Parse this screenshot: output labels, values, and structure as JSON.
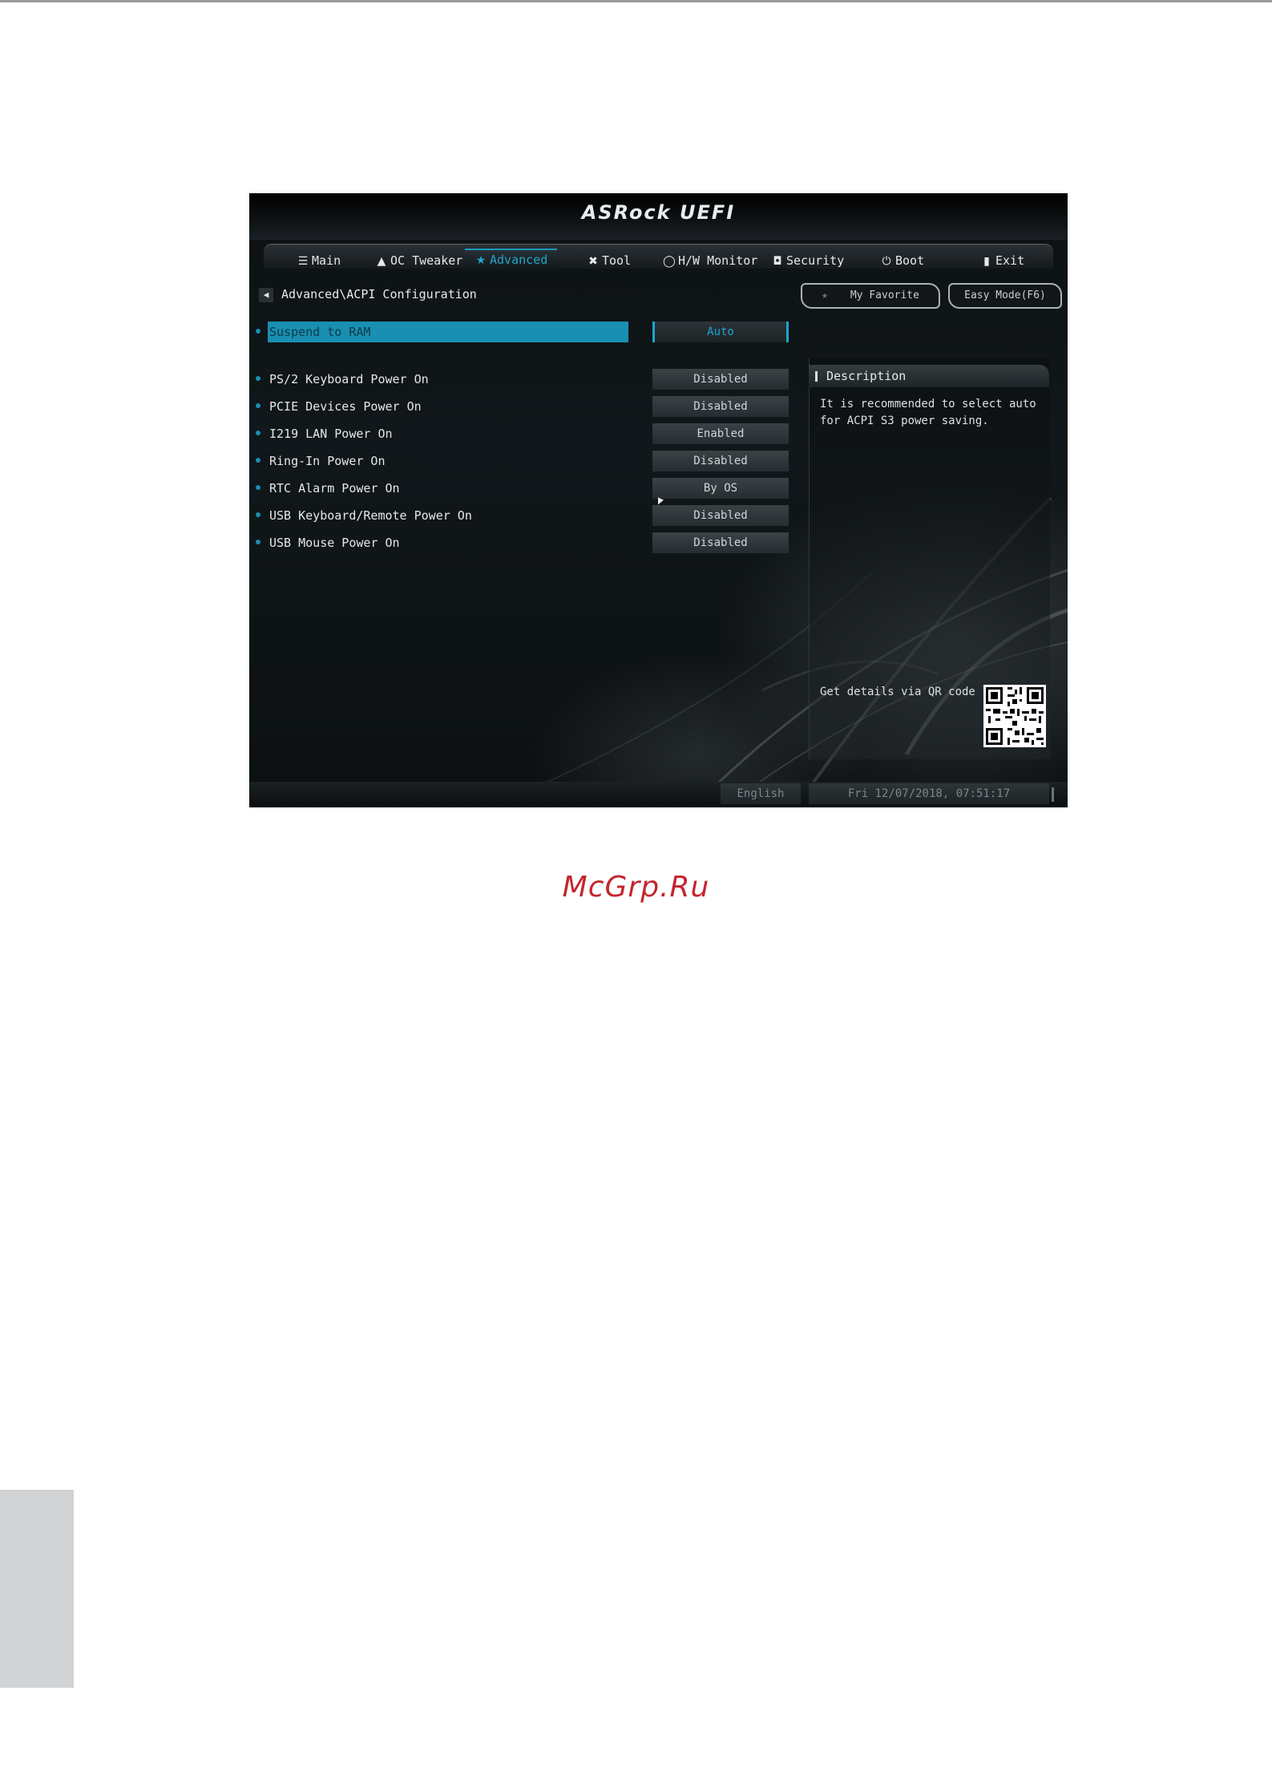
{
  "uefi": {
    "brand": "ASRock UEFI",
    "tabs": [
      {
        "label": "Main",
        "icon": "list-icon",
        "glyph": "☰"
      },
      {
        "label": "OC Tweaker",
        "icon": "flame-icon",
        "glyph": "▲"
      },
      {
        "label": "Advanced",
        "icon": "star-icon",
        "glyph": "★"
      },
      {
        "label": "Tool",
        "icon": "wrench-icon",
        "glyph": "✖"
      },
      {
        "label": "H/W Monitor",
        "icon": "monitor-icon",
        "glyph": "◯"
      },
      {
        "label": "Security",
        "icon": "shield-icon",
        "glyph": "◘"
      },
      {
        "label": "Boot",
        "icon": "power-icon",
        "glyph": "⏻"
      },
      {
        "label": "Exit",
        "icon": "exit-icon",
        "glyph": "▮"
      }
    ],
    "active_tab": "Advanced",
    "breadcrumb": "Advanced\\ACPI Configuration",
    "my_favorite": "My Favorite",
    "easy_mode": "Easy Mode(F6)",
    "settings": [
      {
        "label": "Suspend to RAM",
        "value": "Auto",
        "selected": true
      },
      {
        "label": "PS/2 Keyboard Power On",
        "value": "Disabled"
      },
      {
        "label": "PCIE Devices Power On",
        "value": "Disabled"
      },
      {
        "label": "I219 LAN Power On",
        "value": "Enabled"
      },
      {
        "label": "Ring-In Power On",
        "value": "Disabled"
      },
      {
        "label": "RTC Alarm Power On",
        "value": "By OS"
      },
      {
        "label": "USB Keyboard/Remote Power On",
        "value": "Disabled"
      },
      {
        "label": "USB Mouse Power On",
        "value": "Disabled"
      }
    ],
    "description": {
      "title": "Description",
      "text": "It is recommended to select auto\nfor ACPI S3 power saving.",
      "qr_label": "Get details via QR code"
    },
    "status": {
      "language": "English",
      "datetime": "Fri 12/07/2018, 07:51:17"
    },
    "colors": {
      "accent": "#198fb1",
      "background": "#0f1417"
    }
  },
  "watermark": "McGrp.Ru"
}
